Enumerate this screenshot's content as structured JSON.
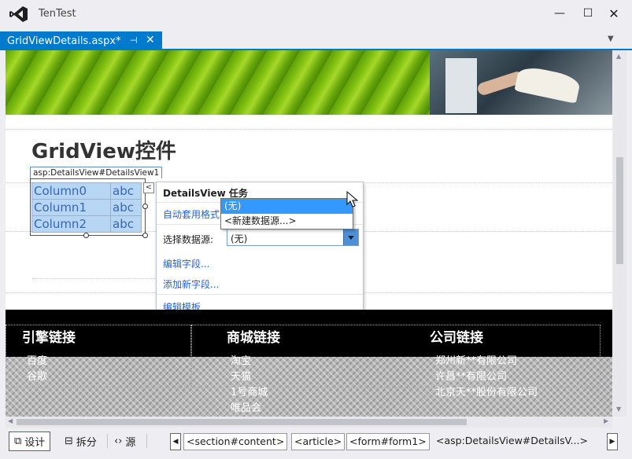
{
  "window": {
    "title": "TenTest",
    "minimize_glyph": "—",
    "maximize_glyph": "☐",
    "close_glyph": "✕"
  },
  "tab": {
    "label": "GridViewDetails.aspx*",
    "pin_glyph": "⊣",
    "close_glyph": "✕",
    "dropdown_glyph": "▼"
  },
  "page": {
    "heading": "GridView控件",
    "detailsview_tag": "asp:DetailsView#DetailsView1",
    "detailsview_rows": [
      {
        "field": "Column0",
        "value": "abc"
      },
      {
        "field": "Column1",
        "value": "abc"
      },
      {
        "field": "Column2",
        "value": "abc"
      }
    ],
    "smarttag_glyph": "<"
  },
  "tasks_panel": {
    "title": "DetailsView 任务",
    "auto_format": "自动套用格式...",
    "datasource_label": "选择数据源:",
    "datasource_value": "(无)",
    "datasource_options": [
      "(无)",
      "<新建数据源...>"
    ],
    "edit_fields": "编辑字段...",
    "add_field": "添加新字段...",
    "edit_templates": "编辑模板"
  },
  "footer": {
    "columns": [
      {
        "heading": "引擎链接",
        "items": [
          "百度",
          "谷歌"
        ]
      },
      {
        "heading": "商城链接",
        "items": [
          "淘宝",
          "天猫",
          "1号商城",
          "唯品会"
        ]
      },
      {
        "heading": "公司链接",
        "items": [
          "郑州新**有限公司",
          "许昌**有限公司",
          "北京天**股份有限公司"
        ]
      }
    ]
  },
  "bottom_bar": {
    "views": [
      {
        "icon": "design-icon",
        "glyph": "⧉",
        "label": "设计",
        "active": true
      },
      {
        "icon": "split-icon",
        "glyph": "⊟",
        "label": "拆分",
        "active": false
      },
      {
        "icon": "source-icon",
        "glyph": "‹›",
        "label": "源",
        "active": false
      }
    ],
    "breadcrumbs": [
      "<section#content>",
      "<article>",
      "<form#form1>",
      "<asp:DetailsView#DetailsV...>"
    ],
    "nav_left_glyph": "◀",
    "nav_right_glyph": "▶"
  },
  "colors": {
    "accent": "#007acc",
    "selection": "#3399ff",
    "link": "#2b63c6"
  }
}
